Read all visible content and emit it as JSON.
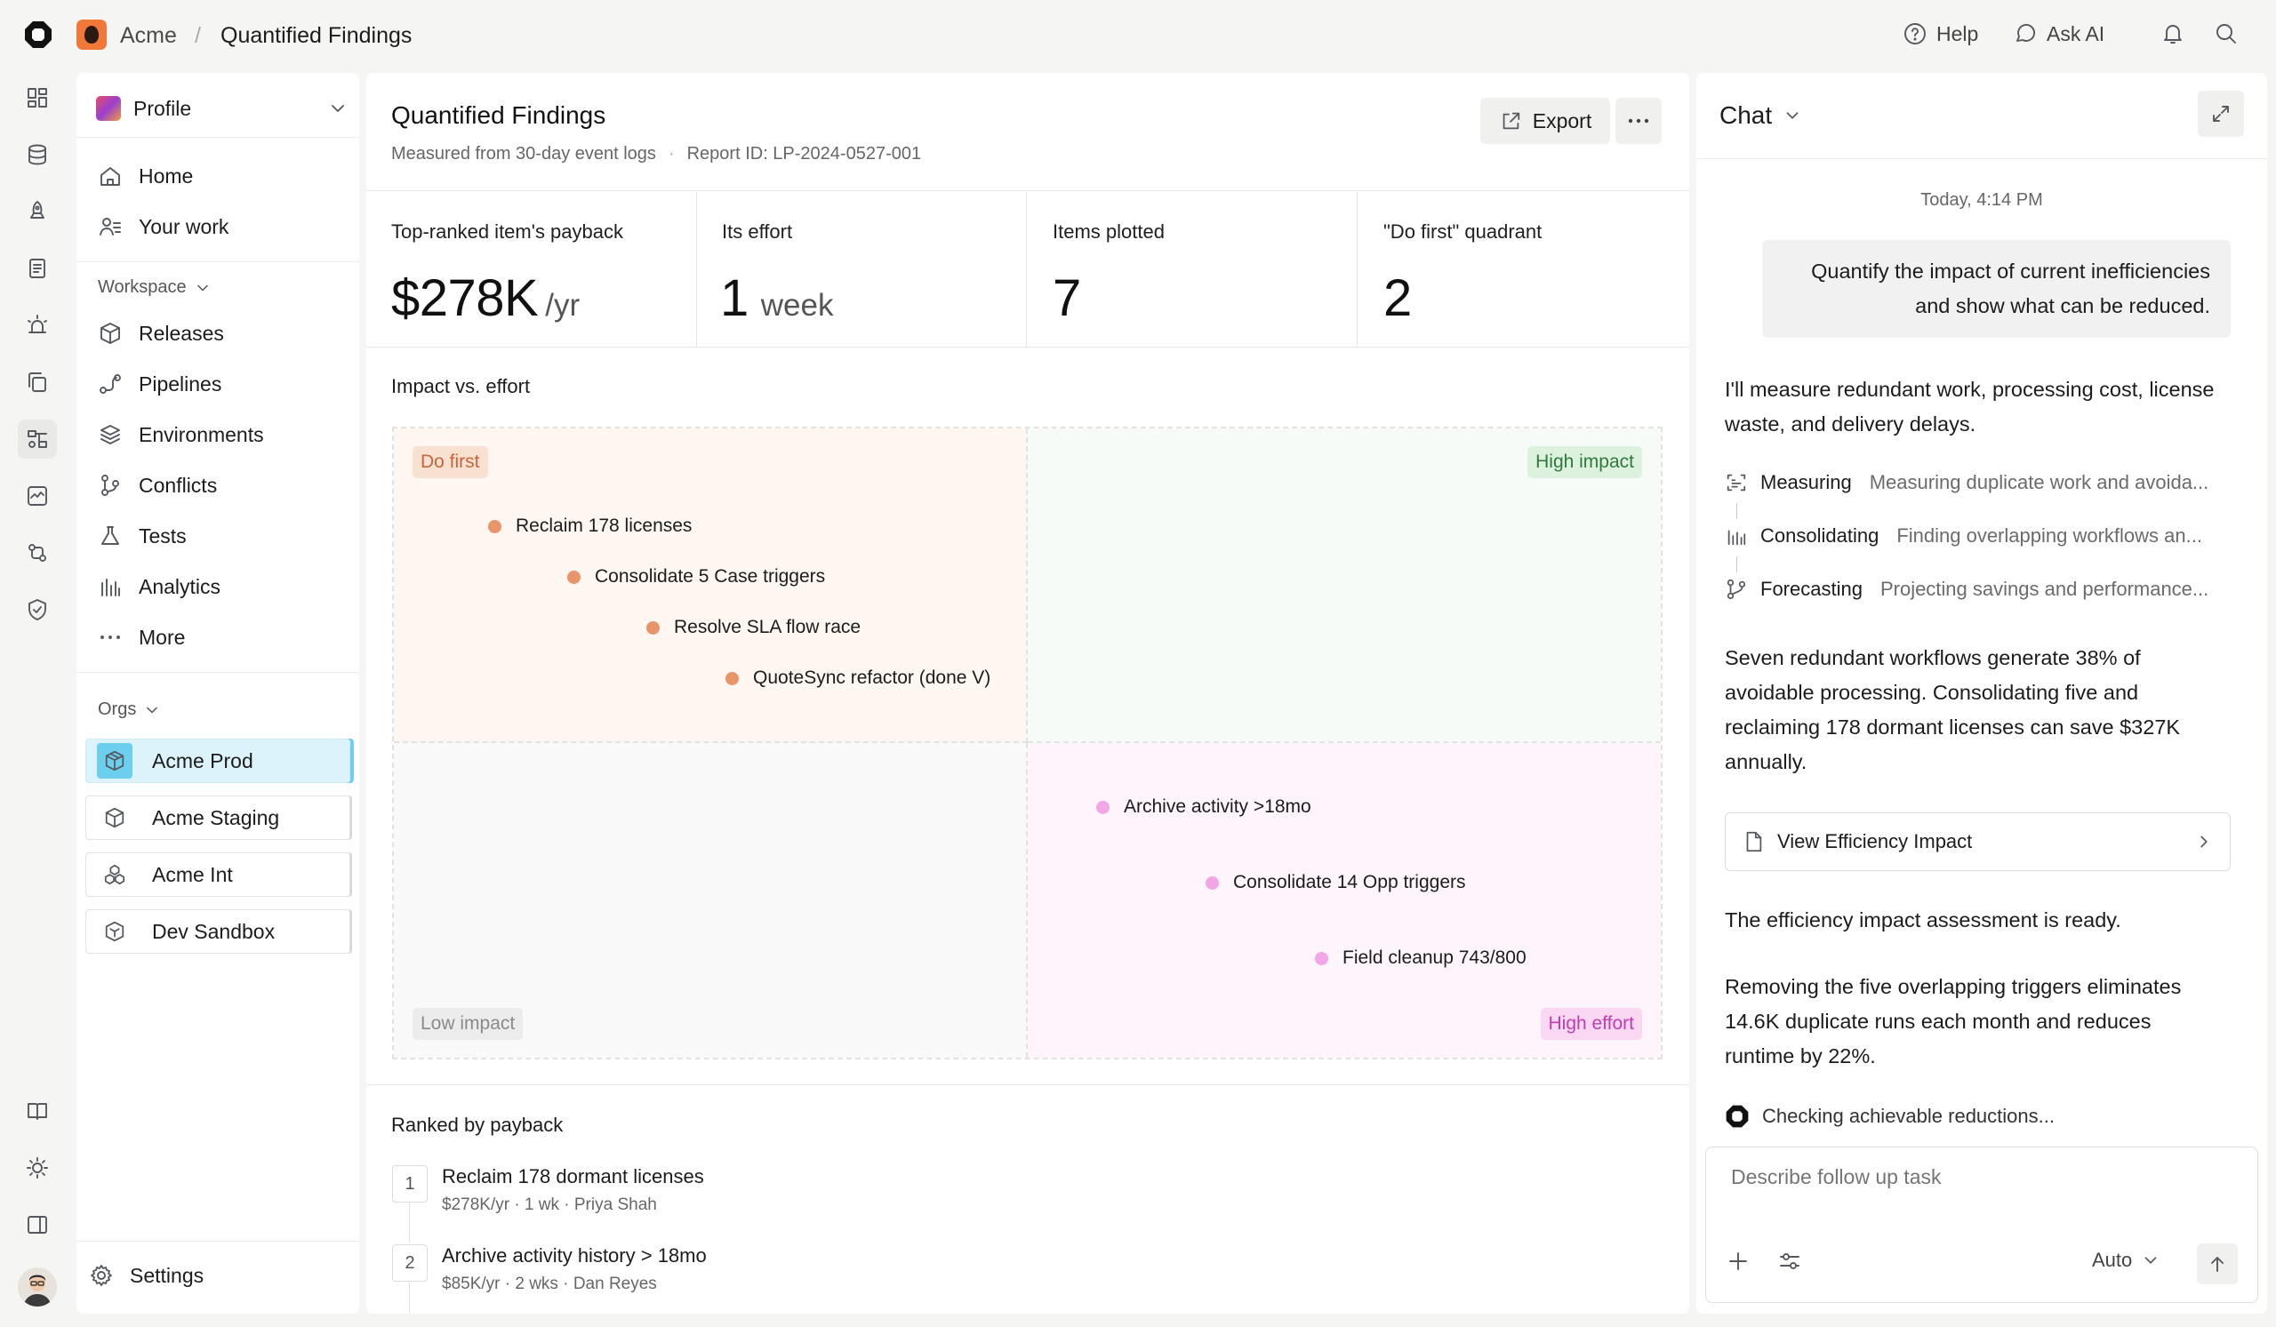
{
  "topbar": {
    "org": "Acme",
    "separator": "/",
    "page": "Quantified Findings",
    "help": "Help",
    "ask_ai": "Ask AI"
  },
  "sidebar": {
    "profile": "Profile",
    "nav": [
      {
        "label": "Home",
        "icon": "home-icon"
      },
      {
        "label": "Your work",
        "icon": "user-list-icon"
      }
    ],
    "workspace_label": "Workspace",
    "workspace": [
      {
        "label": "Releases",
        "icon": "box-icon"
      },
      {
        "label": "Pipelines",
        "icon": "pipeline-icon"
      },
      {
        "label": "Environments",
        "icon": "layers-icon"
      },
      {
        "label": "Conflicts",
        "icon": "merge-icon"
      },
      {
        "label": "Tests",
        "icon": "flask-icon"
      },
      {
        "label": "Analytics",
        "icon": "bar-chart-icon"
      },
      {
        "label": "More",
        "icon": "ellipsis-icon"
      }
    ],
    "orgs_label": "Orgs",
    "orgs": [
      {
        "label": "Acme Prod",
        "active": true
      },
      {
        "label": "Acme Staging",
        "active": false
      },
      {
        "label": "Acme Int",
        "active": false
      },
      {
        "label": "Dev Sandbox",
        "active": false
      }
    ],
    "settings": "Settings"
  },
  "report": {
    "title": "Quantified Findings",
    "subtitle": "Measured from 30-day event logs",
    "report_id": "Report ID: LP-2024-0527-001",
    "export": "Export",
    "kpis": [
      {
        "label": "Top-ranked item's payback",
        "value": "$278K",
        "unit": "/yr"
      },
      {
        "label": "Its effort",
        "value": "1",
        "unit": "week"
      },
      {
        "label": "Items plotted",
        "value": "7",
        "unit": ""
      },
      {
        "label": "\"Do first\" quadrant",
        "value": "2",
        "unit": ""
      }
    ],
    "quadrant_title": "Impact vs. effort",
    "quadrant_labels": {
      "do_first": "Do first",
      "high_impact": "High impact",
      "low_impact": "Low impact",
      "high_effort": "High effort"
    },
    "points": [
      {
        "label": "Reclaim 178 licenses",
        "color": "#e8956a"
      },
      {
        "label": "Consolidate 5 Case triggers",
        "color": "#e8956a"
      },
      {
        "label": "Resolve SLA flow race",
        "color": "#e8956a"
      },
      {
        "label": "QuoteSync refactor (done V)",
        "color": "#e8956a"
      },
      {
        "label": "Archive activity >18mo",
        "color": "#f2a6e6"
      },
      {
        "label": "Consolidate 14 Opp triggers",
        "color": "#f2a6e6"
      },
      {
        "label": "Field cleanup 743/800",
        "color": "#f2a6e6"
      }
    ],
    "ranked_title": "Ranked by payback",
    "ranked": [
      {
        "rank": "1",
        "title": "Reclaim 178 dormant licenses",
        "meta": "$278K/yr · 1 wk · Priya Shah"
      },
      {
        "rank": "2",
        "title": "Archive activity history > 18mo",
        "meta": "$85K/yr · 2 wks · Dan Reyes"
      }
    ]
  },
  "chat": {
    "title": "Chat",
    "timestamp": "Today, 4:14 PM",
    "user_message": "Quantify the impact of current inefficiencies and show what can be reduced.",
    "reply_intro": "I'll measure redundant work, processing cost, license waste, and delivery delays.",
    "steps": [
      {
        "title": "Measuring",
        "detail": "Measuring duplicate work and avoida...",
        "icon": "scan-icon"
      },
      {
        "title": "Consolidating",
        "detail": "Finding overlapping workflows an...",
        "icon": "bars-icon"
      },
      {
        "title": "Forecasting",
        "detail": "Projecting savings and performance...",
        "icon": "branch-icon"
      }
    ],
    "summary": "Seven redundant workflows generate 38% of avoidable processing. Consolidating five and reclaiming 178 dormant licenses can save $327K annually.",
    "card_label": "View Efficiency Impact",
    "ready": "The efficiency impact assessment is ready.",
    "detail": "Removing the five overlapping triggers eliminates 14.6K duplicate runs each month and reduces runtime by 22%.",
    "status": "Checking achievable reductions...",
    "input_placeholder": "Describe follow up task",
    "model": "Auto"
  }
}
